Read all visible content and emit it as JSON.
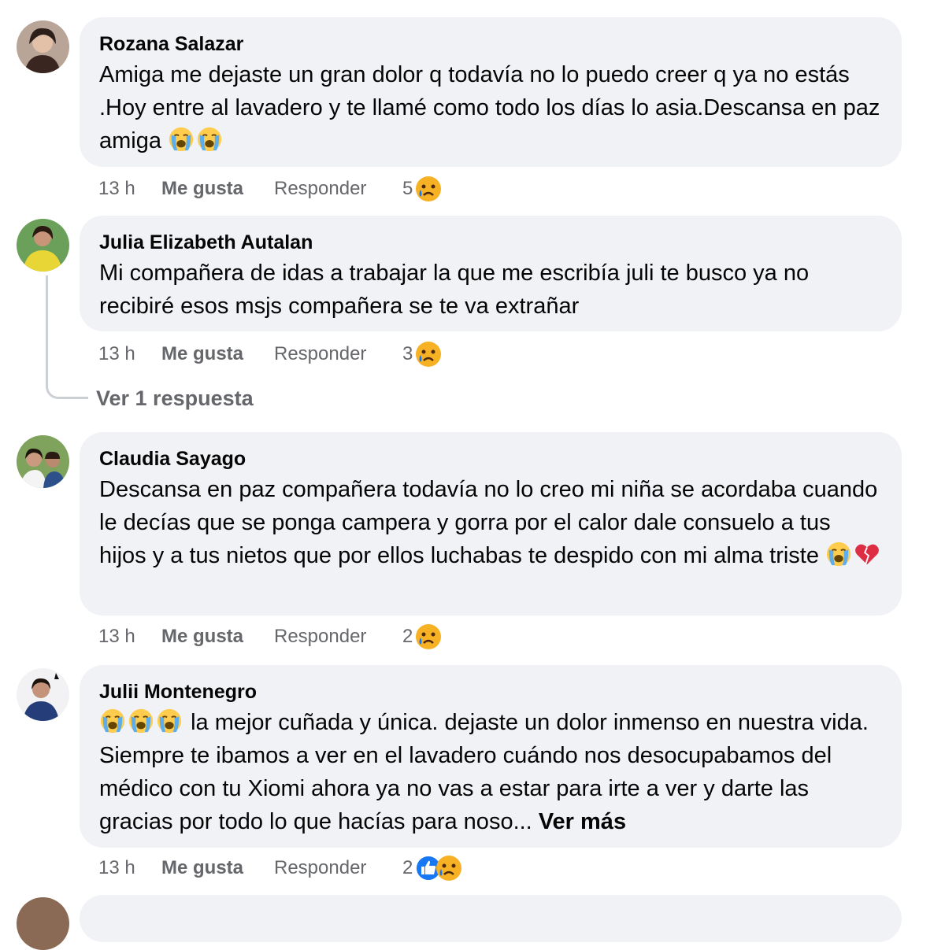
{
  "comments": [
    {
      "author": "Rozana Salazar",
      "text": "Amiga me dejaste un gran dolor q todavía no lo puedo creer q ya no estás .Hoy entre al lavadero y te llamé como todo los días lo asia.Descansa en paz amiga",
      "time": "13 h",
      "like_label": "Me gusta",
      "reply_label": "Responder",
      "reaction_count": "5"
    },
    {
      "author": "Julia Elizabeth Autalan",
      "text": "Mi compañera de idas a trabajar la que me escribía juli te busco ya no recibiré esos msjs compañera se te va extrañar",
      "time": "13 h",
      "like_label": "Me gusta",
      "reply_label": "Responder",
      "reaction_count": "3",
      "view_replies": "Ver 1 respuesta"
    },
    {
      "author": "Claudia Sayago",
      "text": "Descansa en paz compañera todavía no lo creo mi niña se acordaba cuando le decías que se ponga campera y gorra por el calor dale consuelo a tus hijos y a tus nietos que por ellos luchabas te despido con mi alma triste",
      "time": "13 h",
      "like_label": "Me gusta",
      "reply_label": "Responder",
      "reaction_count": "2"
    },
    {
      "author": "Julii Montenegro",
      "text": "la mejor cuñada y única. dejaste un dolor inmenso en nuestra vida. Siempre te ibamos a ver en el lavadero cuándo nos desocupabamos del médico con tu Xiomi ahora ya no vas a estar para irte a ver y darte las gracias por todo lo que hacías para noso...",
      "see_more": "Ver más",
      "time": "13 h",
      "like_label": "Me gusta",
      "reply_label": "Responder",
      "reaction_count": "2"
    }
  ],
  "icons": {
    "crying_emoji": "loudly-crying-face",
    "broken_heart": "broken-heart",
    "sad_reaction": "sad-reaction",
    "like_reaction": "like-reaction"
  },
  "colors": {
    "bubble_bg": "#f0f2f5",
    "secondary_text": "#65676b",
    "like_blue": "#1877f2",
    "reaction_yellow": "#f7b125"
  }
}
